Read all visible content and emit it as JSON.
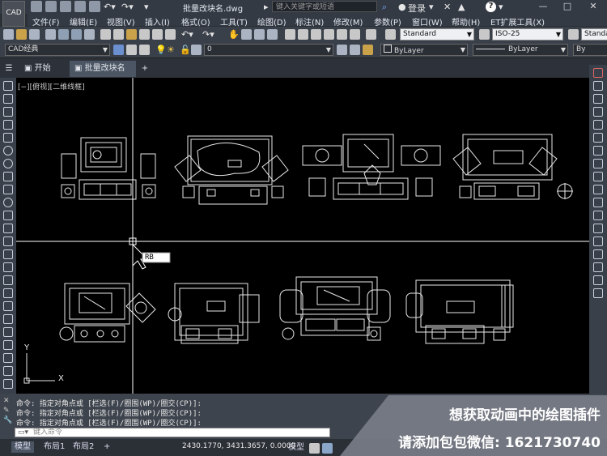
{
  "title": {
    "logo_text": "CAD",
    "document": "批量改块名.dwg",
    "search_placeholder": "键入关键字或短语",
    "login": "登录",
    "help": "?"
  },
  "menu": [
    "文件(F)",
    "编辑(E)",
    "视图(V)",
    "插入(I)",
    "格式(O)",
    "工具(T)",
    "绘图(D)",
    "标注(N)",
    "修改(M)",
    "参数(P)",
    "窗口(W)",
    "帮助(H)",
    "ET扩展工具(X)"
  ],
  "toolbar": {
    "text_style": "Standard",
    "dim_style": "ISO-25",
    "table_style": "Standa",
    "workspace": "CAD经典",
    "layer": "0",
    "color": "ByLayer",
    "linetype": "ByLayer",
    "lineweight": "By"
  },
  "tabs": {
    "start": "开始",
    "active": "批量改块名",
    "add": "+"
  },
  "viewport_label": "[−][俯视][二维线框]",
  "cursor_input": "RB",
  "ucs": {
    "x": "X",
    "y": "Y"
  },
  "command_history": [
    "命令: 指定对角点或 [栏选(F)/圈围(WP)/圈交(CP)]:",
    "命令: 指定对角点或 [栏选(F)/圈围(WP)/圈交(CP)]:",
    "命令: 指定对角点或 [栏选(F)/圈围(WP)/圈交(CP)]:"
  ],
  "command_placeholder": "键入命令",
  "status": {
    "tab_model": "模型",
    "tab_layout1": "布局1",
    "tab_layout2": "布局2",
    "coordinates": "2430.1770, 3431.3657, 0.0000",
    "mode": "模型"
  },
  "promo": {
    "line1": "想获取动画中的绘图插件",
    "line2": "请添加包包微信: 1621730740"
  },
  "colors": {
    "canvas": "#000000",
    "crosshair": "#ffffff",
    "accent": "#5b7cff"
  }
}
